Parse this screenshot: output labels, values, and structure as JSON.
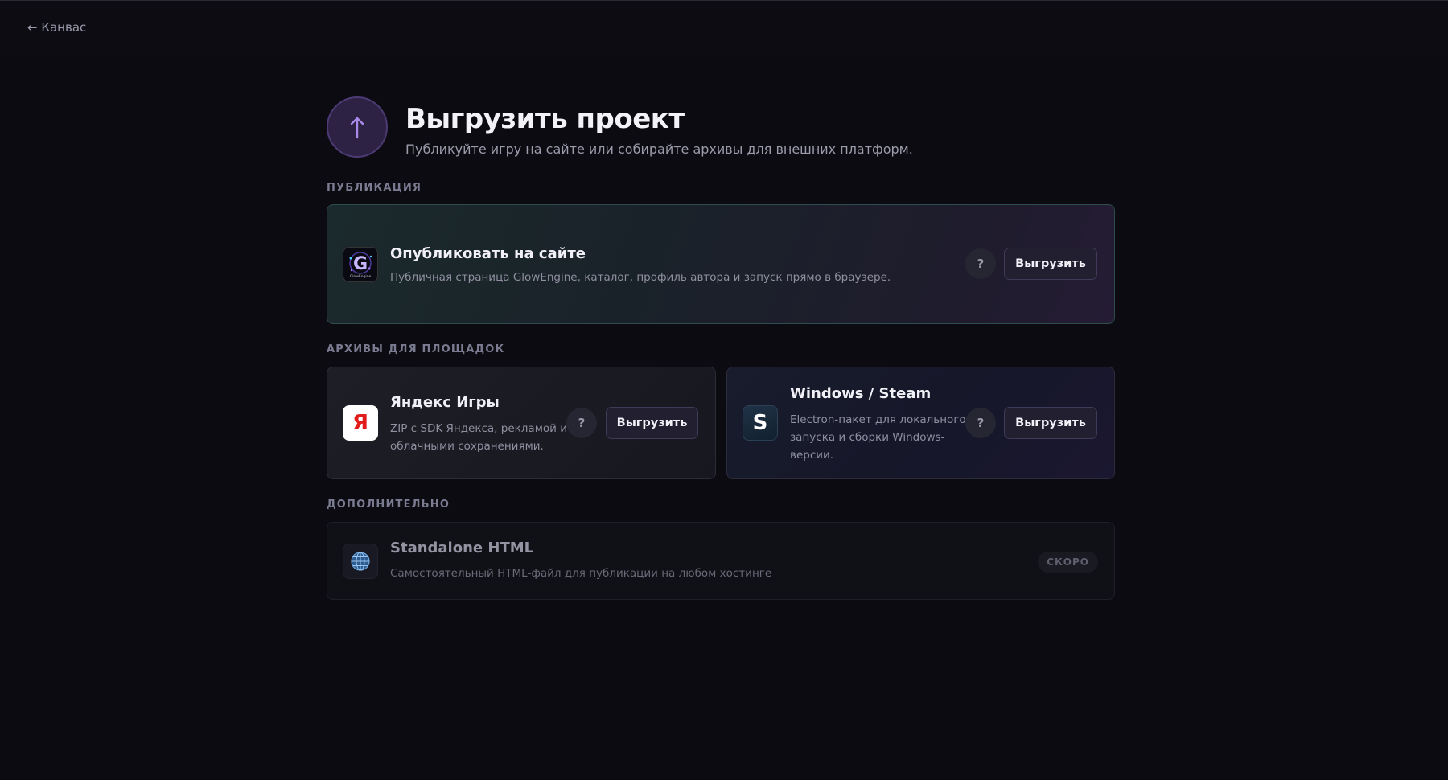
{
  "nav": {
    "back_label": "← Канвас"
  },
  "header": {
    "icon": "arrow-up-icon",
    "title": "Выгрузить проект",
    "subtitle": "Публикуйте игру на сайте или собирайте архивы для внешних платформ."
  },
  "sections": {
    "publication": "ПУБЛИКАЦИЯ",
    "archives": "АРХИВЫ ДЛЯ ПЛОЩАДОК",
    "extra": "ДОПОЛНИТЕЛЬНО"
  },
  "publish_card": {
    "title": "Опубликовать на сайте",
    "description": "Публичная страница GlowEngine, каталог, профиль автора и запуск прямо в браузере.",
    "help": "?",
    "button": "Выгрузить",
    "logo_text": "GlowEngine"
  },
  "yandex_card": {
    "icon_letter": "Я",
    "title": "Яндекс Игры",
    "description_line1": "ZIP с SDK Яндекса, рекламой и",
    "description_line2": "облачными сохранениями.",
    "help": "?",
    "button": "Выгрузить"
  },
  "steam_card": {
    "icon_letter": "S",
    "title": "Windows / Steam",
    "description_line1": "Electron-пакет для локального",
    "description_line2": "запуска и сборки Windows-",
    "description_line3": "версии.",
    "help": "?",
    "button": "Выгрузить"
  },
  "html_card": {
    "icon": "globe-icon",
    "title": "Standalone HTML",
    "description": "Самостоятельный HTML-файл для публикации на любом хостинге",
    "badge": "СКОРО"
  },
  "colors": {
    "background": "#0b0b11",
    "accent": "#a98ae8",
    "yandex_red": "#e21b1b"
  }
}
